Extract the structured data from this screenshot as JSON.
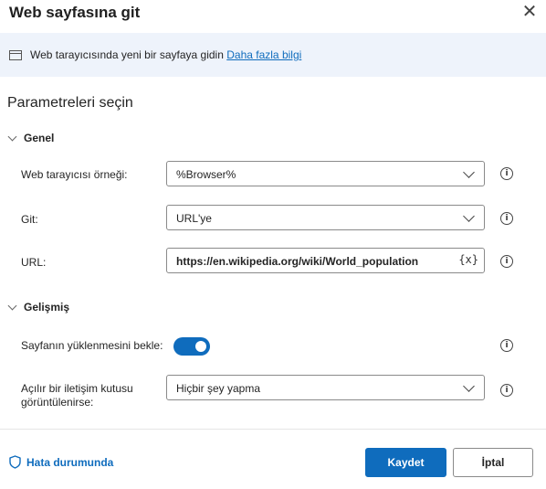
{
  "dialog": {
    "title": "Web sayfasına git",
    "close_icon": "close-icon"
  },
  "banner": {
    "icon": "browser-window-icon",
    "text": "Web tarayıcısında yeni bir sayfaya gidin",
    "link": "Daha fazla bilgi"
  },
  "section_title": "Parametreleri seçin",
  "groups": {
    "general": {
      "label": "Genel",
      "fields": {
        "browser": {
          "label": "Web tarayıcısı örneği:",
          "value": "%Browser%"
        },
        "navigate": {
          "label": "Git:",
          "value": "URL'ye"
        },
        "url": {
          "label": "URL:",
          "value": "https://en.wikipedia.org/wiki/World_population",
          "var_button": "{x}"
        }
      }
    },
    "advanced": {
      "label": "Gelişmiş",
      "fields": {
        "wait_load": {
          "label": "Sayfanın yüklenmesini bekle:",
          "value": true
        },
        "dialog_appears": {
          "label_line1": "Açılır bir iletişim kutusu",
          "label_line2": "görüntülenirse:",
          "value": "Hiçbir şey yapma"
        }
      }
    }
  },
  "info_glyph": "i",
  "footer": {
    "error_link": "Hata durumunda",
    "save": "Kaydet",
    "cancel": "İptal"
  },
  "colors": {
    "accent": "#0f6cbd",
    "banner_bg": "#eef3fb",
    "border": "#8a8a8a"
  }
}
